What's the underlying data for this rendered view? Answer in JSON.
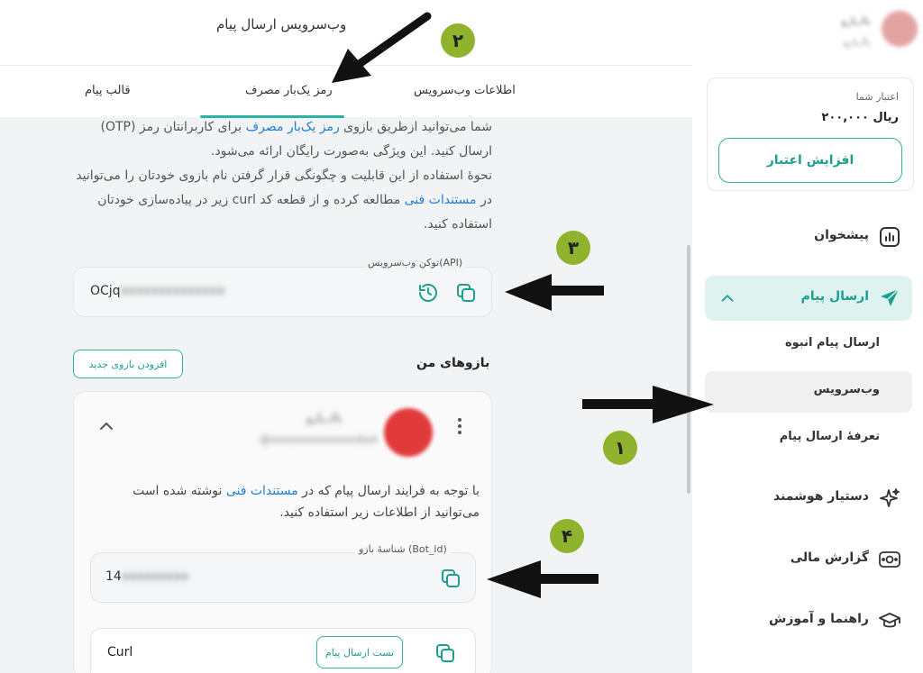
{
  "header": {
    "title": "وب‌سرویس ارسال پیام"
  },
  "tabs": [
    {
      "label": "اطلاعات وب‌سرویس"
    },
    {
      "label": "رمز یک‌بار مصرف"
    },
    {
      "label": "قالب پیام"
    }
  ],
  "description": {
    "line1_part1": "شما می‌توانید ازطریق بازوی ",
    "line1_link": "رمز یک‌بار مصرف",
    "line1_part2": " برای کاربرانتان رمز (OTP) ارسال کنید. این ویژگی به‌صورت رایگان ارائه می‌شود.",
    "line2_part1": "نحوهٔ استفاده از این قابلیت و چگونگی قرار گرفتن نام بازوی خودتان را می‌توانید در ",
    "line2_link": "مستندات فنی",
    "line2_part2": " مطالعه کرده و از قطعه کد curl زیر در پیاده‌سازی خودتان استفاده کنید."
  },
  "token": {
    "label": "توکن وب‌سرویس(API)",
    "value_prefix": "OCjq",
    "value_hidden": "xxxxxxxxxxxxxx"
  },
  "bots": {
    "title": "بازوهای من",
    "add_button": "افزودن بازوی جدید",
    "card": {
      "name": "بالـ‌ـ‌بازو",
      "username": "@xxxxxxxxxxxxxxbot",
      "desc_part1": "با توجه به فرایند ارسال پیام که در ",
      "desc_link": "مستندات فنی",
      "desc_part2": " نوشته شده است می‌توانید از اطلاعات زیر استفاده کنید.",
      "bot_id_label": "شناسهٔ بازو (Bot_id)",
      "bot_id_prefix": "14",
      "bot_id_hidden": "xxxxxxxxx",
      "curl_label": "Curl",
      "test_button": "تست ارسال پیام"
    }
  },
  "annotations": {
    "badge1": "۱",
    "badge2": "۲",
    "badge3": "۳",
    "badge4": "۴"
  },
  "sidebar": {
    "user_name": "بالـ‌بازو",
    "user_sub": "بالـ‌بازو",
    "credit_label": "اعتبار شما",
    "credit_value": "۲۰۰,۰۰۰ ریال",
    "credit_button": "افزایش اعتبار",
    "nav": [
      {
        "label": "پیشخوان",
        "icon": "chart-icon"
      },
      {
        "label": "ارسال پیام",
        "icon": "send-icon"
      },
      {
        "label": "دستیار هوشمند",
        "icon": "sparkle-icon"
      },
      {
        "label": "گزارش مالی",
        "icon": "money-icon"
      },
      {
        "label": "راهنما و آموزش",
        "icon": "graduation-cap-icon"
      }
    ],
    "sub_nav": [
      {
        "label": "ارسال پیام انبوه"
      },
      {
        "label": "وب‌سرویس"
      },
      {
        "label": "تعرفهٔ ارسال پیام"
      }
    ]
  },
  "colors": {
    "accent": "#2bb3a3",
    "accent_light": "#def3ef",
    "link": "#1f7fd4",
    "badge": "#8fb32c"
  }
}
